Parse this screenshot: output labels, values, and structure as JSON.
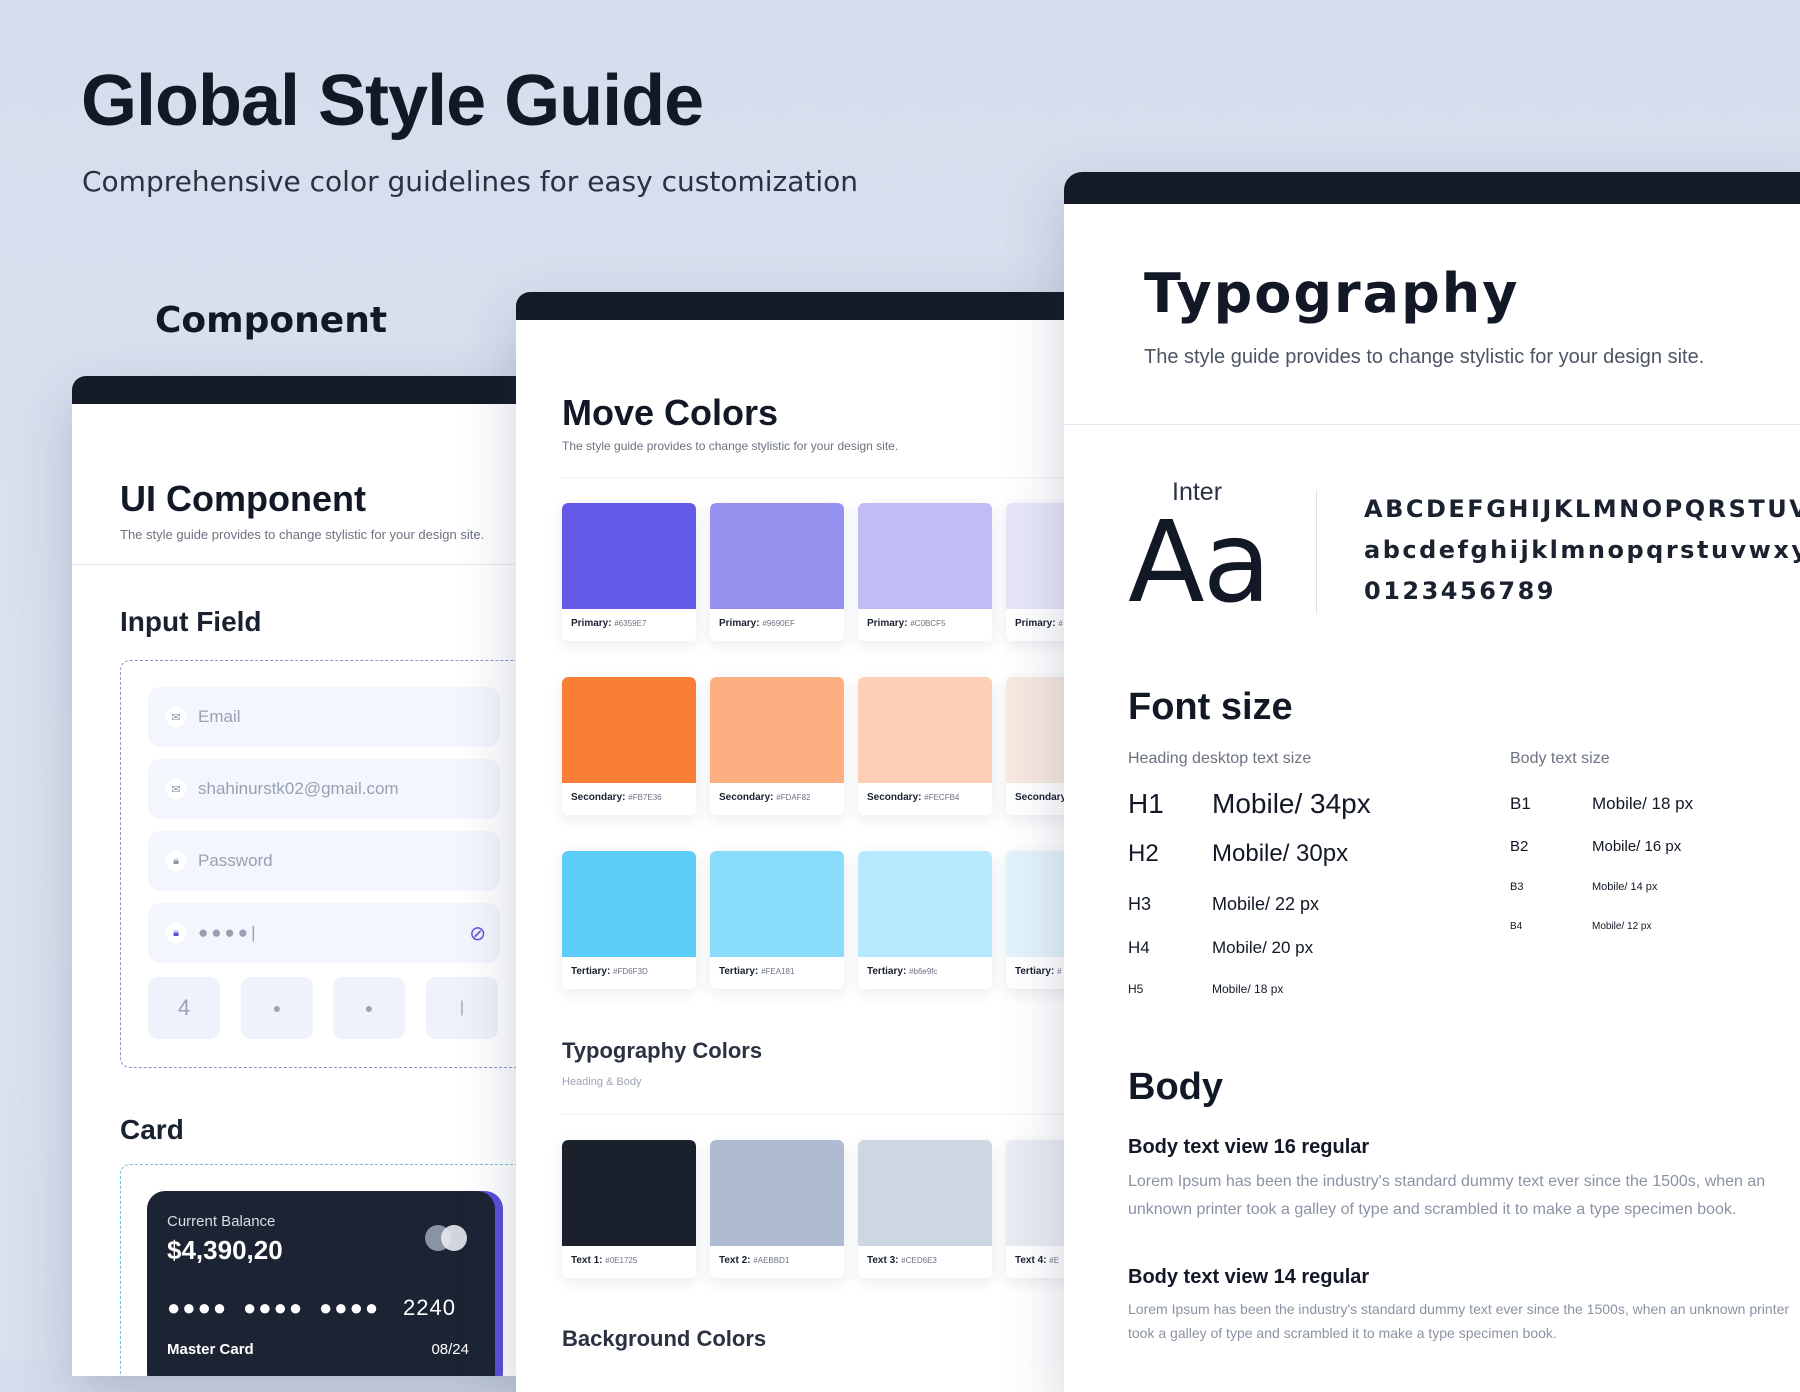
{
  "hero": {
    "title": "Global Style Guide",
    "subtitle": "Comprehensive color guidelines for easy customization"
  },
  "component_panel": {
    "label": "Component",
    "title": "UI Component",
    "description": "The style guide provides to change stylistic for your design site.",
    "input_section": "Input Field",
    "fields": [
      {
        "icon": "mail-icon",
        "text": "Email"
      },
      {
        "icon": "mail-icon",
        "text": "shahinurstk02@gmail.com"
      },
      {
        "icon": "lock-icon",
        "text": "Password"
      },
      {
        "icon": "lock-icon",
        "text": "●●●●|"
      }
    ],
    "otp": [
      "4",
      "●",
      "●",
      "|"
    ],
    "card_section": "Card",
    "card": {
      "balance_label": "Current Balance",
      "balance": "$4,390,20",
      "groups": [
        "●●●●",
        "●●●●",
        "●●●●",
        "2240"
      ],
      "name": "Master Card",
      "expiry": "08/24"
    }
  },
  "colors_panel": {
    "title": "Move Colors",
    "description": "The style guide provides to change stylistic for your design site.",
    "rows": [
      [
        {
          "name": "Primary:",
          "code": "#6359E7",
          "color": "#6359E7"
        },
        {
          "name": "Primary:",
          "code": "#9690EF",
          "color": "#9690EF"
        },
        {
          "name": "Primary:",
          "code": "#C0BCF5",
          "color": "#C0BCF5"
        },
        {
          "name": "Primary:",
          "code": "#",
          "color": "#E6E5F8"
        }
      ],
      [
        {
          "name": "Secondary:",
          "code": "#FB7E36",
          "color": "#FB7E36"
        },
        {
          "name": "Secondary:",
          "code": "#FDAF82",
          "color": "#FDAF82"
        },
        {
          "name": "Secondary:",
          "code": "#FECFB4",
          "color": "#FECFB4"
        },
        {
          "name": "Secondary",
          "code": "",
          "color": "#F7E8E0"
        }
      ],
      [
        {
          "name": "Tertiary:",
          "code": "#FD6F3D",
          "color": "#5CCDF8"
        },
        {
          "name": "Tertiary:",
          "code": "#FEA181",
          "color": "#8ADCFB"
        },
        {
          "name": "Tertiary:",
          "code": "#b6e9fc",
          "color": "#B6E9FC"
        },
        {
          "name": "Tertiary:",
          "code": "#",
          "color": "#E3F3FA"
        }
      ]
    ],
    "typo_title": "Typography Colors",
    "typo_sub": "Heading & Body",
    "text_swatches": [
      {
        "name": "Text 1:",
        "code": "#0E1725",
        "color": "#1A202C"
      },
      {
        "name": "Text 2:",
        "code": "#AEBBD1",
        "color": "#AEBBD1"
      },
      {
        "name": "Text 3:",
        "code": "#CED6E3",
        "color": "#CED6E3"
      },
      {
        "name": "Text 4:",
        "code": "#E",
        "color": "#E9ECF2"
      }
    ],
    "bg_title": "Background Colors"
  },
  "typography_panel": {
    "title": "Typography",
    "description": "The style guide provides to change stylistic for your design site.",
    "font_name": "Inter",
    "sample": "Aa",
    "uppercase": "ABCDEFGHIJKLMNOPQRSTUVWXYZ",
    "lowercase": "abcdefghijklmnopqrstuvwxyz",
    "digits": "0123456789",
    "font_size_title": "Font size",
    "heading_caption": "Heading desktop text size",
    "body_caption": "Body text size",
    "headings": [
      {
        "label": "H1",
        "value": "Mobile/ 34px"
      },
      {
        "label": "H2",
        "value": "Mobile/ 30px"
      },
      {
        "label": "H3",
        "value": "Mobile/ 22 px"
      },
      {
        "label": "H4",
        "value": "Mobile/ 20 px"
      },
      {
        "label": "H5",
        "value": "Mobile/ 18 px"
      }
    ],
    "bodies": [
      {
        "label": "B1",
        "value": "Mobile/ 18 px"
      },
      {
        "label": "B2",
        "value": "Mobile/ 16 px"
      },
      {
        "label": "B3",
        "value": "Mobile/ 14 px"
      },
      {
        "label": "B4",
        "value": "Mobile/ 12 px"
      }
    ],
    "body_title": "Body",
    "body16_title": "Body text view 16 regular",
    "body16_text": "Lorem Ipsum has been the industry's standard dummy text ever since the 1500s, when an unknown printer took a galley of  type and scrambled it to make a type specimen book.",
    "body14_title": "Body text view 14 regular",
    "body14_text": "Lorem Ipsum has been the industry's standard dummy text ever since the 1500s, when an unknown printer took a galley of  type and scrambled it to make a type specimen book."
  }
}
